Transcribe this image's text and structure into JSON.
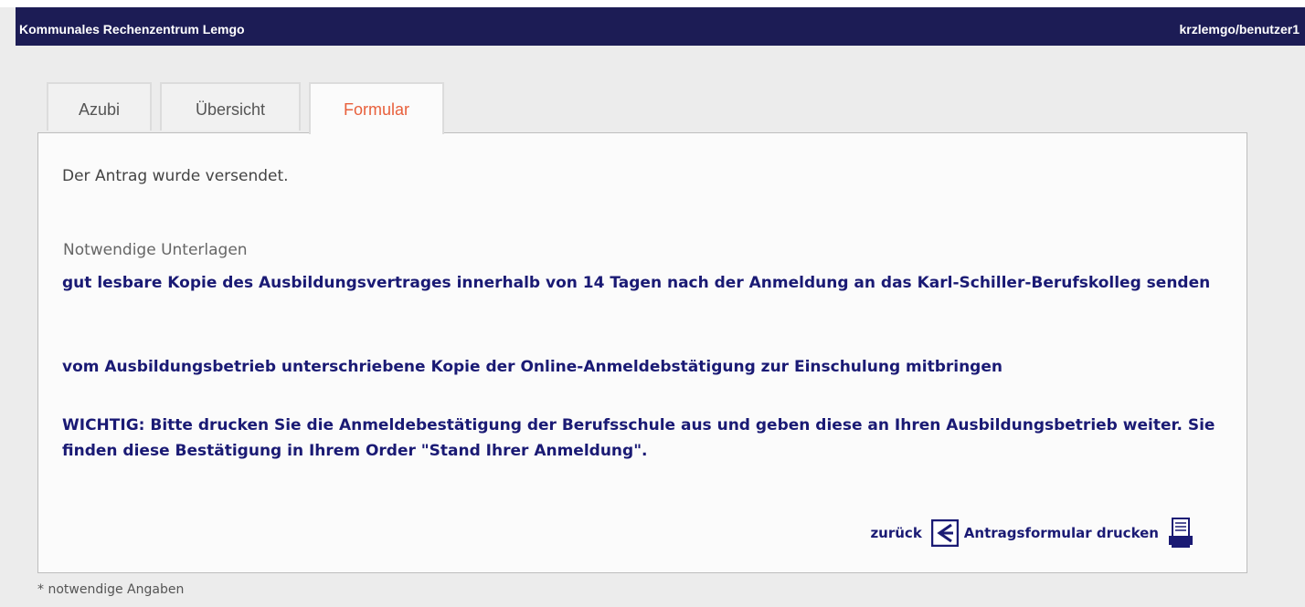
{
  "header": {
    "title": "Kommunales Rechenzentrum Lemgo",
    "user": "krzlemgo/benutzer1",
    "background": "#1c1c55"
  },
  "tabs": [
    {
      "label": "Azubi",
      "active": false
    },
    {
      "label": "Übersicht",
      "active": false
    },
    {
      "label": "Formular",
      "active": true
    }
  ],
  "main": {
    "message": "Der Antrag wurde versendet.",
    "section_title": "Notwendige Unterlagen",
    "requirements": [
      "gut lesbare Kopie des Ausbildungsvertrages innerhalb von 14 Tagen nach der Anmeldung an das Karl-Schiller-Berufskolleg senden",
      "vom Ausbildungsbetrieb unterschriebene Kopie der Online-Anmeldebstätigung zur Einschulung mitbringen",
      "WICHTIG: Bitte drucken Sie die Anmeldebestätigung der Berufsschule aus und geben diese an Ihren Ausbildungsbetrieb weiter. Sie finden diese Bestätigung in Ihrem Order \"Stand Ihrer Anmeldung\"."
    ],
    "actions": {
      "back_label": "zurück",
      "back_icon": "back-arrow-icon",
      "print_label": "Antragsformular drucken",
      "print_icon": "printer-icon"
    }
  },
  "footnote": "* notwendige Angaben",
  "colors": {
    "accent": "#e8603c",
    "link": "#1a1a74"
  }
}
